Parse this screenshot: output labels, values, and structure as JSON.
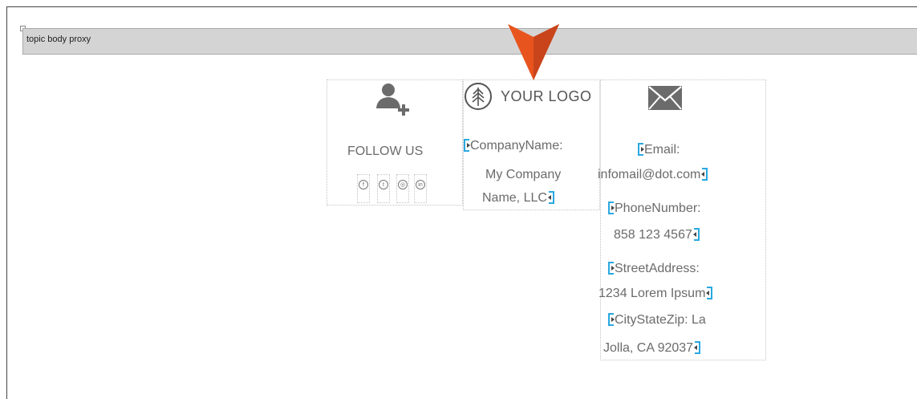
{
  "proxy": {
    "label": "topic body proxy"
  },
  "follow": {
    "title": "FOLLOW US",
    "icons": [
      "facebook-icon",
      "twitter-icon",
      "instagram-icon",
      "linkedin-icon"
    ],
    "glyphs": [
      "f",
      "t",
      "◎",
      "in"
    ]
  },
  "logo": {
    "text": "YOUR LOGO"
  },
  "company": {
    "label": "CompanyName:",
    "value_line1": "My Company",
    "value_line2": "Name, LLC"
  },
  "contact": {
    "email_label": "Email:",
    "email_value": "infomail@dot.com",
    "phone_label": "PhoneNumber:",
    "phone_value": "858 123 4567",
    "street_label": "StreetAddress:",
    "street_value": "1234 Lorem Ipsum",
    "city_label": "CityStateZip: La",
    "city_value": "Jolla, CA 92037"
  },
  "colors": {
    "marker": "#e8541e",
    "tag": "#29a8e0",
    "text": "#6b6b6b"
  }
}
